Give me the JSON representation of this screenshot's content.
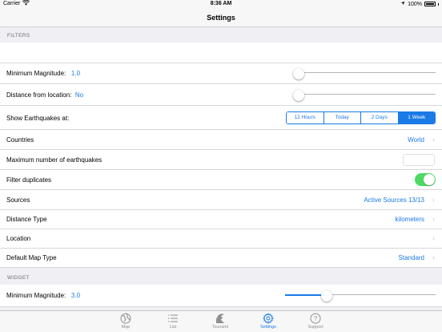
{
  "status_bar": {
    "carrier": "Carrier",
    "time": "8:36 AM",
    "battery": "100%"
  },
  "nav": {
    "title": "Settings"
  },
  "filters": {
    "header": "FILTERS",
    "min_magnitude": {
      "label": "Minimum Magnitude:",
      "value": "1.0",
      "slider_fraction": 0.0
    },
    "distance": {
      "label": "Distance from location:",
      "value": "No",
      "slider_fraction": 0.0
    },
    "show_eq": {
      "label": "Show Earthquakes at:",
      "options": [
        "12 Hours",
        "Today",
        "2 Days",
        "1 Week"
      ],
      "selected": "1 Week"
    },
    "countries": {
      "label": "Countries",
      "value": "World"
    },
    "max_eq": {
      "label": "Maximum number of earthquakes",
      "value": ""
    },
    "filter_dup": {
      "label": "Filter duplicates",
      "on": true
    },
    "sources": {
      "label": "Sources",
      "value": "Active Sources 13/13"
    },
    "distance_type": {
      "label": "Distance Type",
      "value": "kilometers"
    },
    "location": {
      "label": "Location",
      "value": ""
    },
    "map_type": {
      "label": "Default Map Type",
      "value": "Standard"
    }
  },
  "widget": {
    "header": "WIDGET",
    "min_magnitude": {
      "label": "Minimum Magnitude:",
      "value": "3.0",
      "slider_fraction": 0.24
    }
  },
  "tabs": [
    {
      "label": "Map",
      "icon": "globe-icon"
    },
    {
      "label": "List",
      "icon": "list-icon"
    },
    {
      "label": "Tsunami",
      "icon": "wave-icon"
    },
    {
      "label": "Settings",
      "icon": "gear-icon",
      "active": true
    },
    {
      "label": "Support",
      "icon": "help-icon"
    }
  ],
  "colors": {
    "accent": "#1a7ae6",
    "toggle_on": "#4cd964",
    "background": "#efeff4"
  }
}
